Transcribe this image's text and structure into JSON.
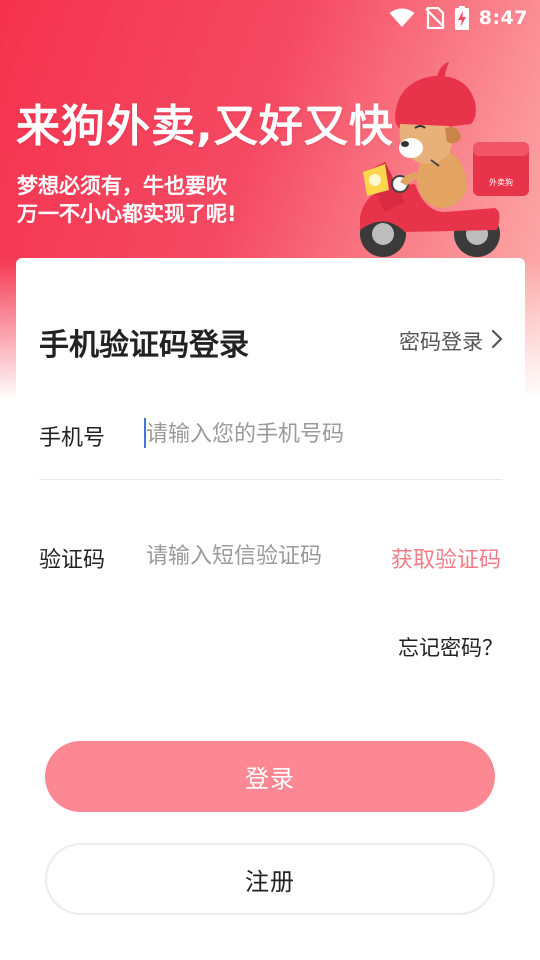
{
  "status_bar": {
    "time": "8:47",
    "icons": [
      "wifi-icon",
      "no-sim-icon",
      "battery-charging-icon"
    ]
  },
  "hero": {
    "title": "来狗外卖,又好又快",
    "subtitle_line1": "梦想必须有，牛也要吹",
    "subtitle_line2": "万一不小心都实现了呢!",
    "mascot_box_text": "外卖狗"
  },
  "login_card": {
    "title": "手机验证码登录",
    "switch_mode_label": "密码登录",
    "phone_label": "手机号",
    "phone_placeholder": "请输入您的手机号码",
    "code_label": "验证码",
    "code_placeholder": "请输入短信验证码",
    "get_code_label": "获取验证码",
    "forgot_label": "忘记密码？",
    "login_button": "登录",
    "register_button": "注册"
  },
  "colors": {
    "brand": "#f5324e",
    "login_button": "#fc8893",
    "get_code_text": "#f47c88"
  }
}
